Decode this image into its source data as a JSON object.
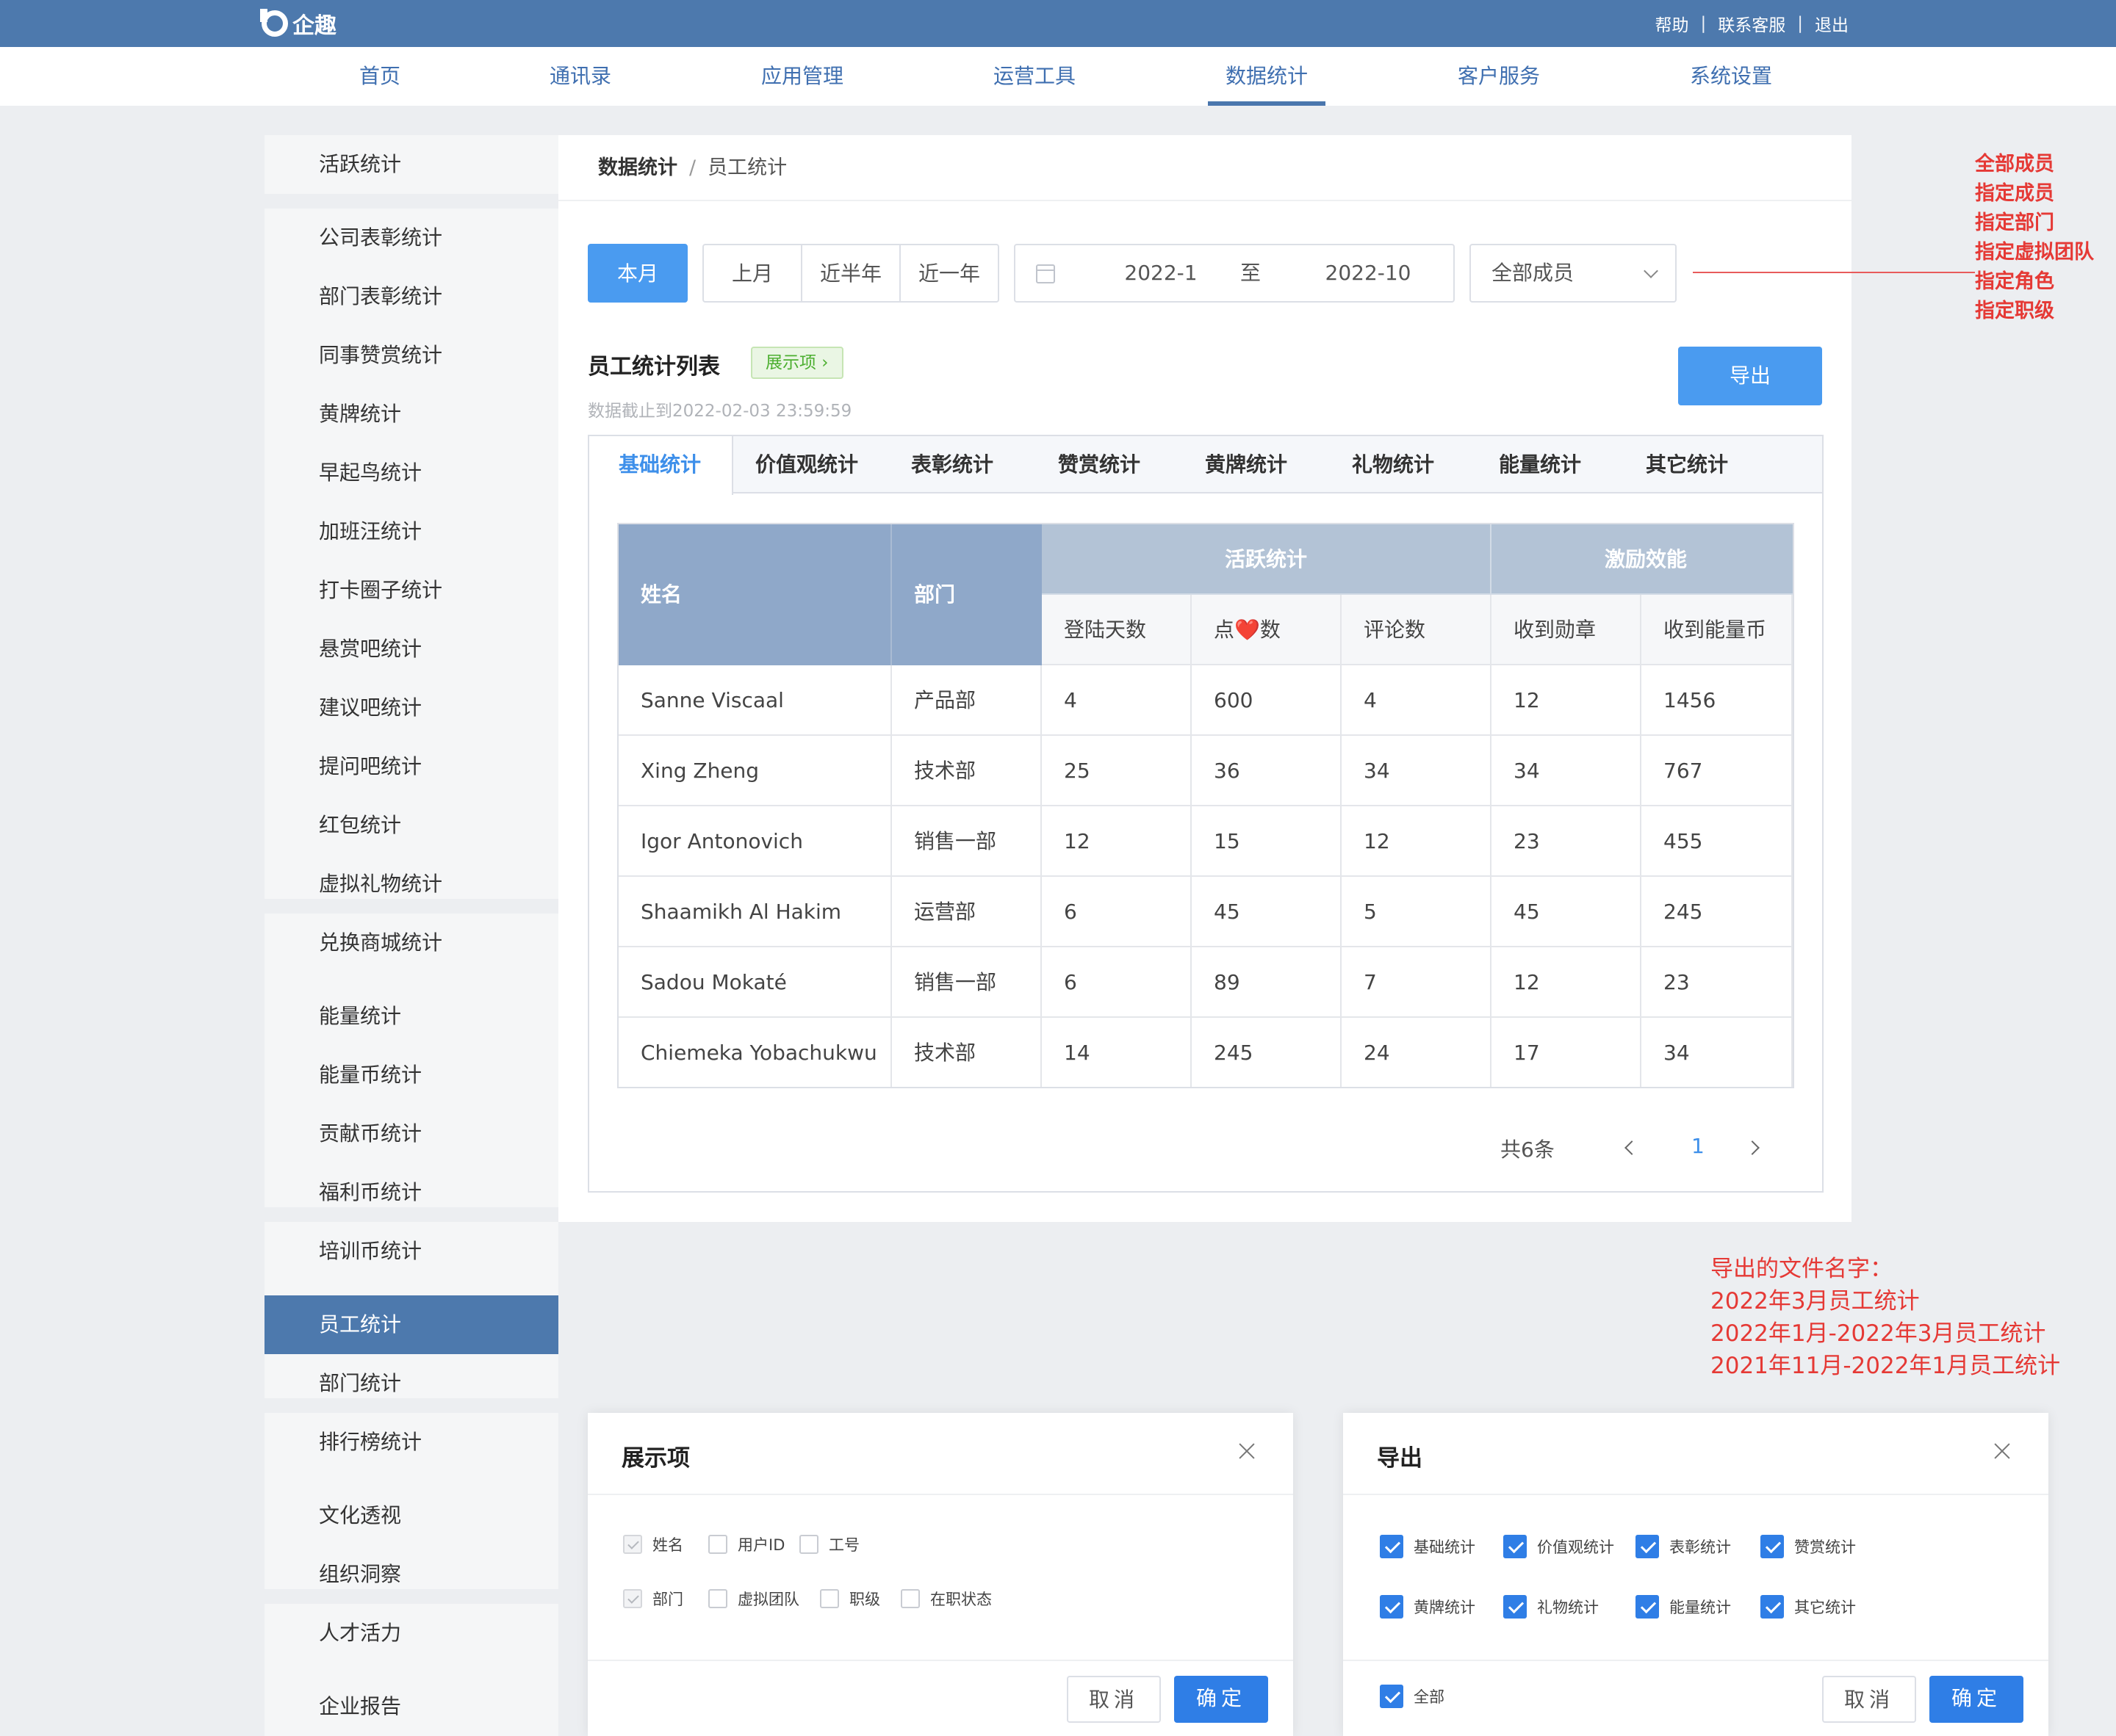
{
  "app": {
    "name": "企趣"
  },
  "topbar": {
    "links": [
      "帮助",
      "联系客服",
      "退出"
    ],
    "sep": "|"
  },
  "nav": {
    "items": [
      "首页",
      "通讯录",
      "应用管理",
      "运营工具",
      "数据统计",
      "客户服务",
      "系统设置"
    ],
    "active": "数据统计"
  },
  "sidebar": {
    "items": [
      "活跃统计",
      "公司表彰统计",
      "部门表彰统计",
      "同事赞赏统计",
      "黄牌统计",
      "早起鸟统计",
      "加班汪统计",
      "打卡圈子统计",
      "悬赏吧统计",
      "建议吧统计",
      "提问吧统计",
      "红包统计",
      "虚拟礼物统计",
      "兑换商城统计",
      "能量统计",
      "能量币统计",
      "贡献币统计",
      "福利币统计",
      "培训币统计",
      "员工统计",
      "部门统计",
      "排行榜统计",
      "文化透视",
      "组织洞察",
      "人才活力",
      "企业报告"
    ],
    "active": "员工统计"
  },
  "breadcrumb": {
    "parent": "数据统计",
    "sep": "/",
    "current": "员工统计"
  },
  "filters": {
    "periods": [
      "本月",
      "上月",
      "近半年",
      "近一年"
    ],
    "active_period": "本月",
    "range_start": "2022-1",
    "range_to": "至",
    "range_end": "2022-10",
    "member_selected": "全部成员"
  },
  "list": {
    "title": "员工统计列表",
    "show_tag": "展示项 ›",
    "cutoff": "数据截止到2022-02-03 23:59:59",
    "export_label": "导出"
  },
  "tabs": {
    "items": [
      "基础统计",
      "价值观统计",
      "表彰统计",
      "赞赏统计",
      "黄牌统计",
      "礼物统计",
      "能量统计",
      "其它统计"
    ],
    "active": "基础统计"
  },
  "table": {
    "group_headers": [
      "活跃统计",
      "激励效能"
    ],
    "name_header": "姓名",
    "dept_header": "部门",
    "sub_headers": [
      "登陆天数",
      "点❤️数",
      "评论数",
      "收到勋章",
      "收到能量币"
    ],
    "rows": [
      [
        "Sanne Viscaal",
        "产品部",
        "4",
        "600",
        "4",
        "12",
        "1456"
      ],
      [
        "Xing Zheng",
        "技术部",
        "25",
        "36",
        "34",
        "34",
        "767"
      ],
      [
        "Igor Antonovich",
        "销售一部",
        "12",
        "15",
        "12",
        "23",
        "455"
      ],
      [
        "Shaamikh Al Hakim",
        "运营部",
        "6",
        "45",
        "5",
        "45",
        "245"
      ],
      [
        "Sadou Mokaté",
        "销售一部",
        "6",
        "89",
        "7",
        "12",
        "23"
      ],
      [
        "Chiemeka Yobachukwu",
        "技术部",
        "14",
        "245",
        "24",
        "17",
        "34"
      ]
    ]
  },
  "pagination": {
    "total": "共6条",
    "current": "1"
  },
  "annotations": {
    "member_options": [
      "全部成员",
      "指定成员",
      "指定部门",
      "指定虚拟团队",
      "指定角色",
      "指定职级"
    ],
    "export_names": [
      "导出的文件名字：",
      "2022年3月员工统计",
      "2022年1月-2022年3月员工统计",
      "2021年11月-2022年1月员工统计"
    ],
    "color": "#e53935"
  },
  "dialog_display": {
    "title": "展示项",
    "row1": [
      {
        "label": "姓名",
        "state": "disabled"
      },
      {
        "label": "用户ID",
        "state": "off"
      },
      {
        "label": "工号",
        "state": "off"
      }
    ],
    "row2": [
      {
        "label": "部门",
        "state": "disabled"
      },
      {
        "label": "虚拟团队",
        "state": "off"
      },
      {
        "label": "职级",
        "state": "off"
      },
      {
        "label": "在职状态",
        "state": "off"
      }
    ],
    "cancel": "取消",
    "ok": "确定"
  },
  "dialog_export": {
    "title": "导出",
    "row1": [
      {
        "label": "基础统计",
        "state": "on"
      },
      {
        "label": "价值观统计",
        "state": "on"
      },
      {
        "label": "表彰统计",
        "state": "on"
      },
      {
        "label": "赞赏统计",
        "state": "on"
      }
    ],
    "row2": [
      {
        "label": "黄牌统计",
        "state": "on"
      },
      {
        "label": "礼物统计",
        "state": "on"
      },
      {
        "label": "能量统计",
        "state": "on"
      },
      {
        "label": "其它统计",
        "state": "on"
      }
    ],
    "all": {
      "label": "全部",
      "state": "on"
    },
    "cancel": "取消",
    "ok": "确定"
  },
  "colors": {
    "topbar": "#4d79ad",
    "primary": "#4a9bf0",
    "header_dark": "#8fa8c9",
    "header_light": "#b3c3d6",
    "active_tab": "#3d8fea"
  }
}
